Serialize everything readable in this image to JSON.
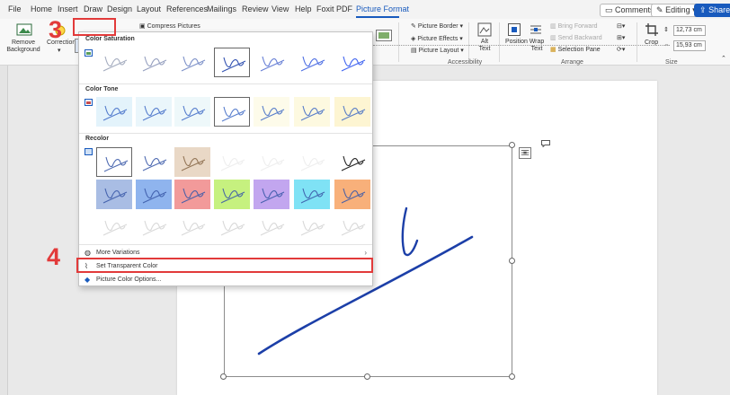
{
  "menu": {
    "items": [
      "File",
      "Home",
      "Insert",
      "Draw",
      "Design",
      "Layout",
      "References",
      "Mailings",
      "Review",
      "View",
      "Help",
      "Foxit PDF",
      "Picture Format"
    ],
    "active": "Picture Format",
    "comments": "Comments",
    "editing": "Editing",
    "share": "Share"
  },
  "ribbon": {
    "remove_background": [
      "Remove",
      "Background"
    ],
    "corrections": "Corrections",
    "color": "Color",
    "compress_pictures": "Compress Pictures",
    "picture_border": "Picture Border",
    "picture_effects": "Picture Effects",
    "picture_layout": "Picture Layout",
    "alt_text": [
      "Alt",
      "Text"
    ],
    "accessibility": "Accessibility",
    "position": "Position",
    "wrap_text": [
      "Wrap",
      "Text"
    ],
    "bring_forward": "Bring Forward",
    "send_backward": "Send Backward",
    "selection_pane": "Selection Pane",
    "arrange": "Arrange",
    "crop": "Crop",
    "height": "12,73 cm",
    "width": "15,93 cm",
    "size": "Size"
  },
  "dropdown": {
    "color_saturation": "Color Saturation",
    "color_tone": "Color Tone",
    "recolor": "Recolor",
    "more_variations": "More Variations",
    "set_transparent_color": "Set Transparent Color",
    "picture_color_options": "Picture Color Options..."
  },
  "steps": {
    "step3": "3",
    "step4": "4"
  },
  "colors": {
    "accent": "#185abd",
    "highlight": "#e23a3a",
    "signature": "#1c3fa8",
    "tone": [
      "#e3f3fb",
      "#eaf6fb",
      "#eef8fa",
      "#ffffff",
      "#fdfbea",
      "#fdf9e0",
      "#fdf5d2"
    ],
    "recolor": [
      "#ffffff",
      "#ffffff",
      "#e9d8c6",
      "#ffffff",
      "#ffffff",
      "#ffffff",
      "#ffffff",
      "#a9bde4",
      "#8fb4ee",
      "#f29a9a",
      "#c6f17f",
      "#c2a6ef",
      "#7fe2f5",
      "#f8b07a",
      "#ffffff",
      "#ffffff",
      "#ffffff",
      "#ffffff",
      "#ffffff",
      "#ffffff",
      "#ffffff"
    ]
  }
}
